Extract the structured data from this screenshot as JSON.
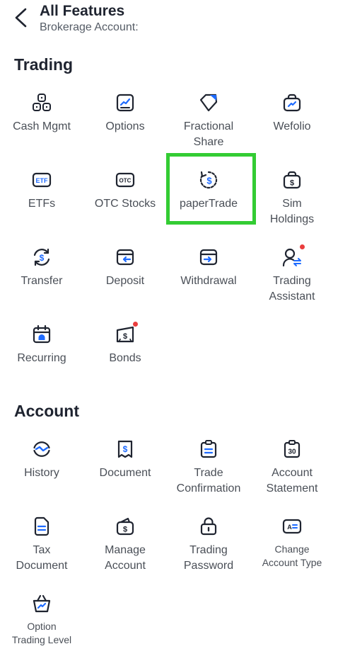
{
  "header": {
    "title": "All Features",
    "subtitle": "Brokerage Account:"
  },
  "colors": {
    "icon": "#1f2430",
    "accent_blue": "#1e6bff",
    "badge_red": "#ea3d3d",
    "highlight_green": "#33cc33"
  },
  "trading": {
    "title": "Trading",
    "items": [
      {
        "label": "Cash Mgmt",
        "icon": "coins-icon"
      },
      {
        "label": "Options",
        "icon": "options-chart-icon"
      },
      {
        "label": "Fractional\nShare",
        "icon": "fractional-share-icon"
      },
      {
        "label": "Wefolio",
        "icon": "wefolio-bag-icon"
      },
      {
        "label": "ETFs",
        "icon": "etf-icon"
      },
      {
        "label": "OTC Stocks",
        "icon": "otc-icon"
      },
      {
        "label": "paperTrade",
        "icon": "paper-trade-icon"
      },
      {
        "label": "Sim\nHoldings",
        "icon": "sim-holdings-icon"
      },
      {
        "label": "Transfer",
        "icon": "transfer-icon"
      },
      {
        "label": "Deposit",
        "icon": "deposit-icon"
      },
      {
        "label": "Withdrawal",
        "icon": "withdrawal-icon"
      },
      {
        "label": "Trading\nAssistant",
        "icon": "trading-assistant-icon"
      },
      {
        "label": "Recurring",
        "icon": "recurring-calendar-icon"
      },
      {
        "label": "Bonds",
        "icon": "bonds-icon"
      }
    ]
  },
  "account": {
    "title": "Account",
    "items": [
      {
        "label": "History",
        "icon": "history-icon"
      },
      {
        "label": "Document",
        "icon": "document-dollar-icon"
      },
      {
        "label": "Trade\nConfirmation",
        "icon": "trade-confirmation-icon"
      },
      {
        "label": "Account\nStatement",
        "icon": "account-statement-icon"
      },
      {
        "label": "Tax\nDocument",
        "icon": "tax-document-icon"
      },
      {
        "label": "Manage\nAccount",
        "icon": "manage-account-icon"
      },
      {
        "label": "Trading\nPassword",
        "icon": "lock-icon"
      },
      {
        "label": "Change\nAccount Type",
        "icon": "id-card-icon"
      },
      {
        "label": "Option\nTrading Level",
        "icon": "option-level-basket-icon"
      }
    ]
  }
}
